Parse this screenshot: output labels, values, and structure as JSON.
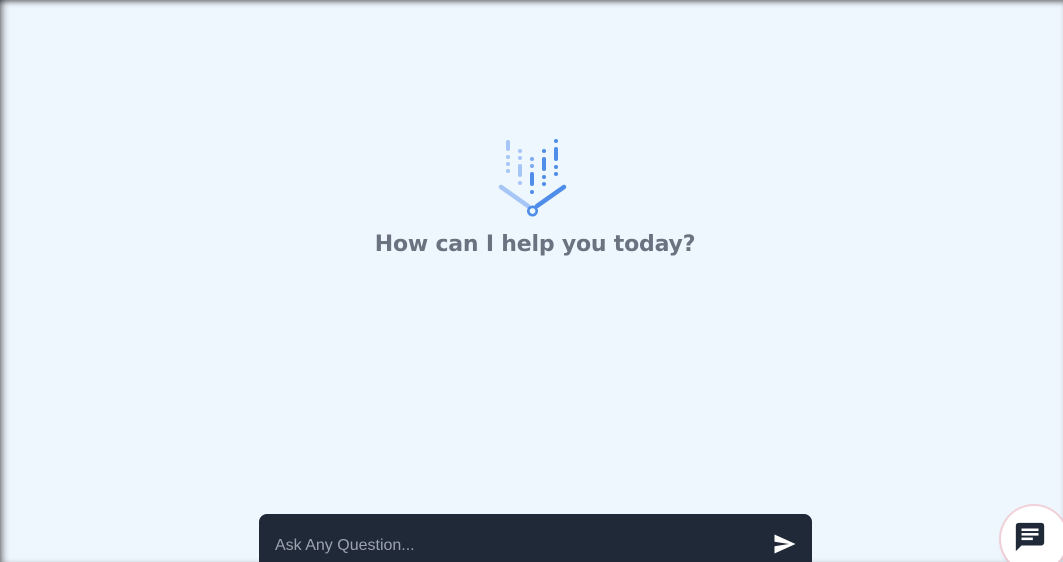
{
  "main": {
    "logo_icon": "bar-chart-shield-icon",
    "greeting": "How can I help you today?"
  },
  "composer": {
    "placeholder": "Ask Any Question...",
    "value": "",
    "send_icon": "send-icon"
  },
  "chat_launcher": {
    "icon": "chat-message-icon"
  },
  "colors": {
    "background": "#eff7fe",
    "composer": "#1f2937",
    "greeting_text": "#6b7280",
    "logo_light": "#a6c6f5",
    "logo_dark": "#4f8ee8"
  }
}
